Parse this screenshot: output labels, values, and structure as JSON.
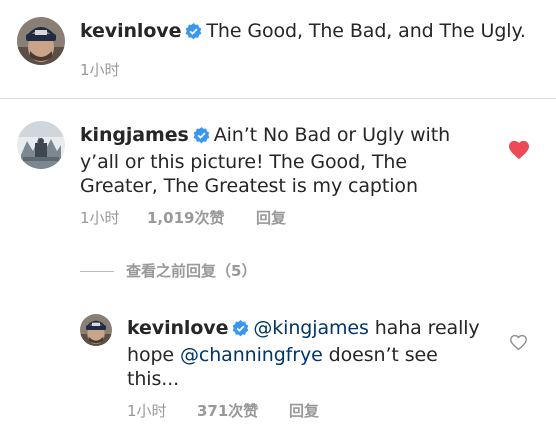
{
  "post": {
    "username": "kevinlove",
    "caption": "The Good, The Bad, and The Ugly.",
    "time": "1小时"
  },
  "comments": [
    {
      "username": "kingjames",
      "text": "Ain’t No Bad or Ugly with y’all or this picture! The Good, The Greater, The Greatest is my caption",
      "time": "1小时",
      "likes": "1,019次赞",
      "reply_label": "回复",
      "liked": true
    }
  ],
  "view_previous_replies": "查看之前回复（5）",
  "reply": {
    "username": "kevinlove",
    "mention1": "@kingjames",
    "text1": "haha really hope",
    "mention2": "@channingfrye",
    "text2": "doesn’t see this...",
    "time": "1小时",
    "likes": "371次赞",
    "reply_label": "回复",
    "liked": false
  },
  "colors": {
    "verified_badge": "#3897f0",
    "liked_heart": "#ed4956",
    "mention": "#003569",
    "meta_text": "#999999"
  },
  "icons": {
    "verified": "verified-badge-icon",
    "liked": "heart-filled-icon",
    "unliked": "heart-outline-icon"
  }
}
